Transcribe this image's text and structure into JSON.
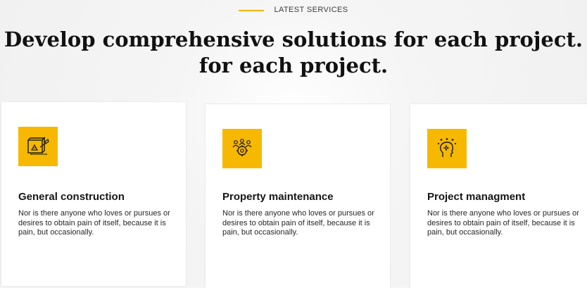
{
  "section": {
    "eyebrow": "LATEST SERVICES",
    "title_line_1": "Develop comprehensive solutions for each project.",
    "title_line_2": "for each project."
  },
  "colors": {
    "accent": "#f6b800",
    "heading": "#111111",
    "body": "#262626",
    "card_bg": "#ffffff"
  },
  "services": [
    {
      "title": "General construction",
      "description": "Nor is there anyone who loves or pursues or desires to obtain pain of itself, because it is pain, but occasionally.",
      "icon": "blueprint-icon"
    },
    {
      "title": "Property maintenance",
      "description": "Nor is there anyone who loves or pursues or desires to obtain pain of itself, because it is pain, but occasionally.",
      "icon": "team-gear-icon"
    },
    {
      "title": "Project managment",
      "description": "Nor is there anyone who loves or pursues or desires to obtain pain of itself, because it is pain, but occasionally.",
      "icon": "head-ideas-icon"
    }
  ]
}
